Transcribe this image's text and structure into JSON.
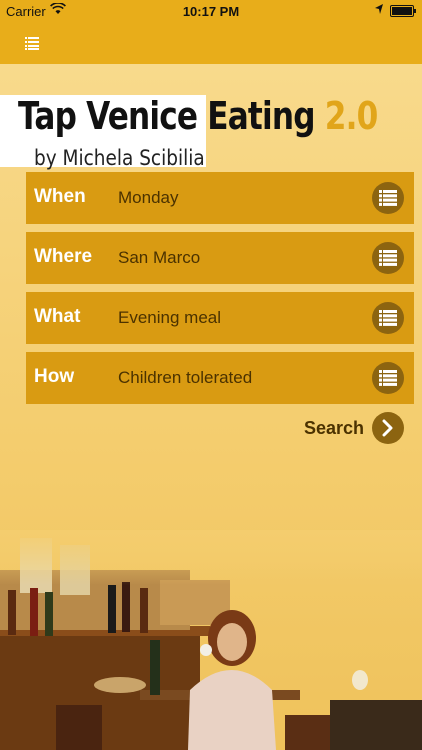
{
  "status_bar": {
    "carrier": "Carrier",
    "time": "10:17 PM"
  },
  "header": {
    "title": "Tap Venice Eating",
    "version": "2.0",
    "byline": "by Michela Scibilia"
  },
  "filters": [
    {
      "label": "When",
      "value": "Monday"
    },
    {
      "label": "Where",
      "value": "San Marco"
    },
    {
      "label": "What",
      "value": "Evening meal"
    },
    {
      "label": "How",
      "value": "Children tolerated"
    }
  ],
  "search": {
    "label": "Search"
  },
  "colors": {
    "accent": "#e8ad1a",
    "row": "#d99b12",
    "button": "#8c6410"
  },
  "icons": {
    "menu": "list-icon",
    "row_action": "list-icon",
    "search": "chevron-right-icon"
  }
}
